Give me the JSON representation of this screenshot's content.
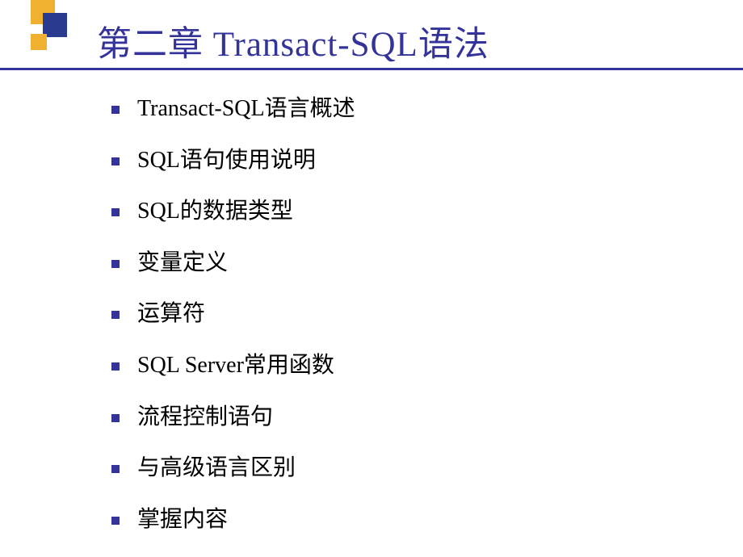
{
  "slide": {
    "title": "第二章 Transact-SQL语法",
    "items": [
      "Transact-SQL语言概述",
      "SQL语句使用说明",
      "SQL的数据类型",
      "变量定义",
      "运算符",
      "SQL Server常用函数",
      "流程控制语句",
      "与高级语言区别",
      "掌握内容"
    ]
  }
}
